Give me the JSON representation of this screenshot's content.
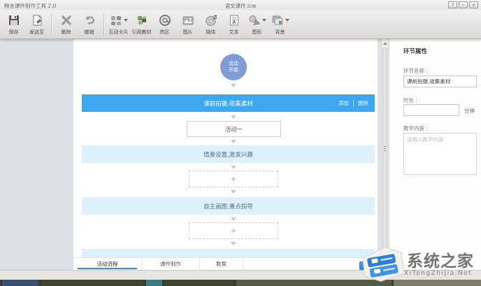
{
  "window": {
    "app_title": "畅言课件制作工具 2.0",
    "document_title": "语文课件.icw",
    "controls": {
      "help": "?",
      "minimize": "−",
      "close": "×"
    }
  },
  "toolbar": {
    "buttons": [
      {
        "label": "保存"
      },
      {
        "label": "发送至"
      },
      {
        "label": "删除"
      },
      {
        "label": "撤销"
      },
      {
        "label": "互动卡片"
      },
      {
        "label": "引用教材"
      },
      {
        "label": "热区"
      },
      {
        "label": "图片"
      },
      {
        "label": "媒体"
      },
      {
        "label": "文本"
      },
      {
        "label": "图形"
      },
      {
        "label": "背景"
      }
    ]
  },
  "flow": {
    "start_top": "活动",
    "start_bottom": "开始",
    "stage_active": {
      "label": "课前拍摄,收集素材",
      "action_add": "添加",
      "action_delete": "删除"
    },
    "activity_label": "活动一",
    "stage2": "情景设置,激发兴趣",
    "stage3": "自主画图,重点指导",
    "plus": "+"
  },
  "tabs": [
    {
      "label": "活动流程"
    },
    {
      "label": "课件制作"
    },
    {
      "label": "教案"
    }
  ],
  "panel": {
    "title": "环节属性",
    "name_label": "环节名称 :",
    "name_value": "课前拍摄,收集素材",
    "duration_label": "时长 :",
    "duration_value": "",
    "duration_unit": "分钟",
    "content_label": "教学内容 :",
    "content_placeholder": "请输入教学内容"
  },
  "watermark": {
    "title": "系统之家",
    "site": "XiTongZhiJia.Net"
  },
  "colors": {
    "accent_blue": "#3aa7f0",
    "light_blue": "#def0fb",
    "node_circle": "#7f9dd5",
    "tab_active_underline": "#3388e8"
  }
}
